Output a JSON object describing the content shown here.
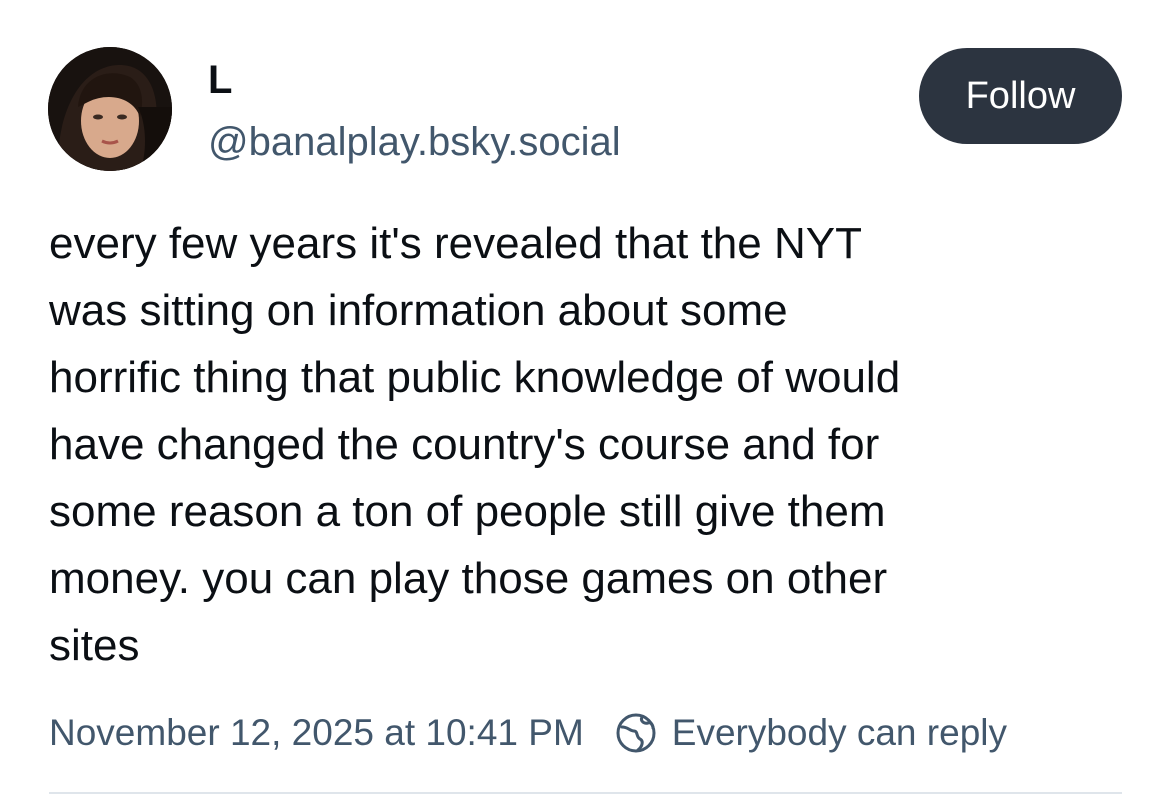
{
  "author": {
    "display_name": "L",
    "handle": "@banalplay.bsky.social",
    "avatar_icon": "user-avatar-photo"
  },
  "follow_button": {
    "label": "Follow",
    "color": "#2c3440"
  },
  "post": {
    "text": "every few years it's revealed that the NYT\nwas sitting on information about some\nhorrific thing that public knowledge of would\nhave changed the country's course and for\nsome reason a ton of people still give them\nmoney. you can play those games on other\nsites"
  },
  "meta": {
    "timestamp": "November 12, 2025 at 10:41 PM",
    "reply_icon": "globe-icon",
    "reply_setting": "Everybody can reply"
  },
  "colors": {
    "text": "#0b0f14",
    "secondary": "#42576c",
    "divider": "#dfe5eb"
  }
}
